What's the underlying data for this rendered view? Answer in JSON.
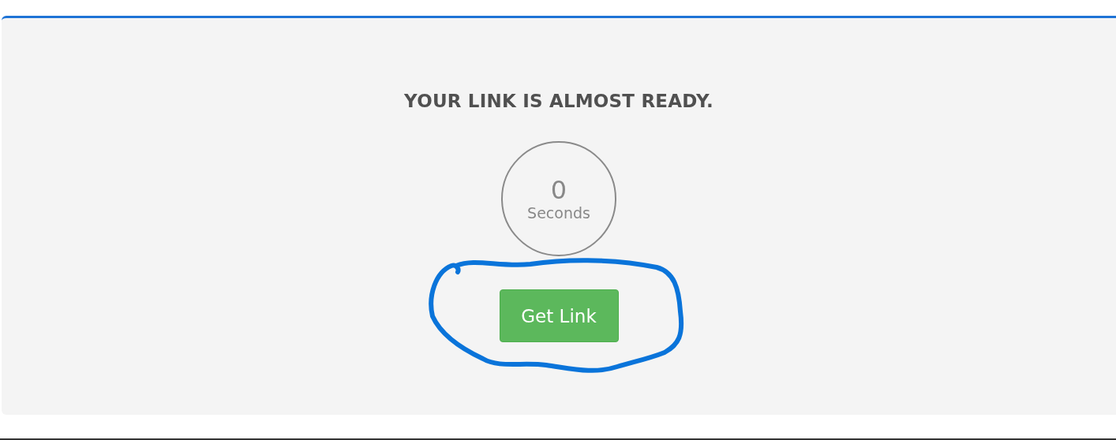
{
  "heading": "YOUR LINK IS ALMOST READY.",
  "countdown": {
    "value": "0",
    "unit": "Seconds"
  },
  "button": {
    "label": "Get Link"
  }
}
